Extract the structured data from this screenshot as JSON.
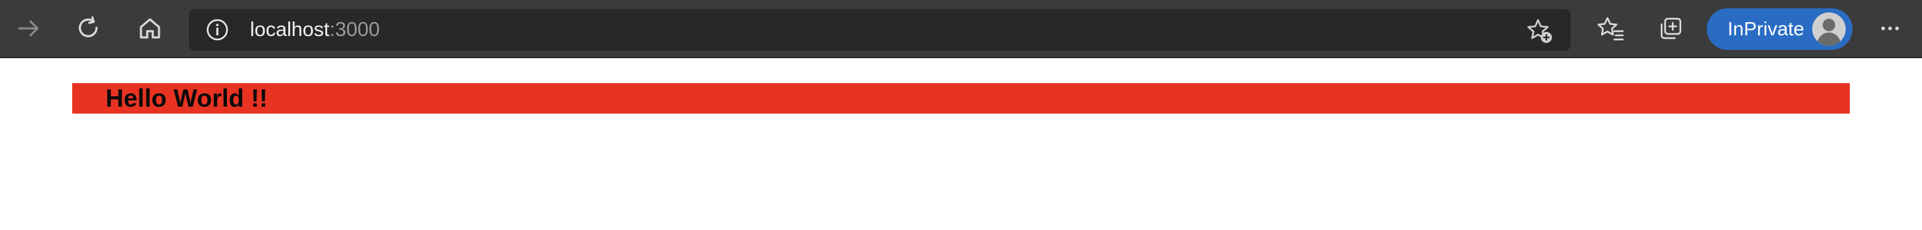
{
  "browser": {
    "url": {
      "host": "localhost",
      "port": ":3000"
    },
    "inprivate_label": "InPrivate",
    "icons": {
      "forward": "forward-arrow-icon",
      "refresh": "refresh-icon",
      "home": "home-icon",
      "info": "info-icon",
      "favorites_add": "star-plus-icon",
      "favorites": "favorites-list-icon",
      "collections": "collections-icon",
      "more": "more-horizontal-icon"
    },
    "colors": {
      "toolbar": "#3b3b3b",
      "address_bar": "#282828",
      "inprivate_pill": "#2a6cc4"
    }
  },
  "page": {
    "heading": "Hello World !!",
    "heading_background": "#e83323"
  }
}
